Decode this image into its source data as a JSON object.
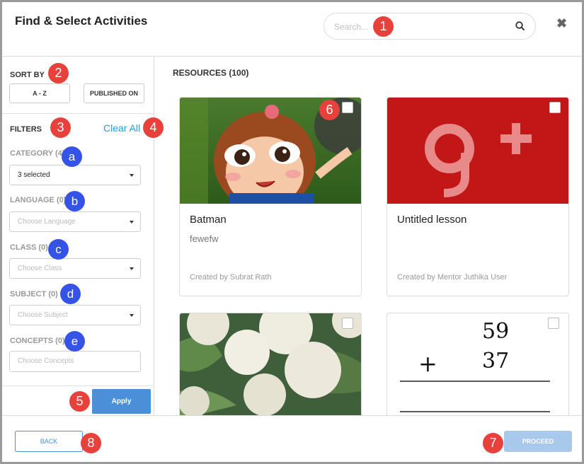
{
  "dialog": {
    "title": "Find & Select Activities",
    "close_glyph": "✖"
  },
  "search": {
    "placeholder": "Search..."
  },
  "sort": {
    "label": "SORT BY",
    "options": [
      "A - Z",
      "PUBLISHED ON"
    ]
  },
  "filters": {
    "label": "FILTERS",
    "clear_label": "Clear All",
    "items": [
      {
        "label": "CATEGORY (4)",
        "value": "3 selected",
        "filled": true
      },
      {
        "label": "LANGUAGE (0)",
        "value": "Choose Language"
      },
      {
        "label": "CLASS (0)",
        "value": "Choose Class"
      },
      {
        "label": "SUBJECT (0)",
        "value": "Choose Subject"
      },
      {
        "label": "CONCEPTS (0)",
        "value": "Choose Concepts"
      }
    ],
    "apply_label": "Apply"
  },
  "resources": {
    "heading": "RESOURCES (100)",
    "cards": [
      {
        "name": "Batman",
        "desc": "fewefw",
        "by": "Created by Subrat Rath",
        "image": "cartoon-girl"
      },
      {
        "name": "Untitled lesson",
        "desc": "",
        "by": "Created by Mentor Juthika User",
        "image": "google-plus-logo"
      },
      {
        "image": "cauliflower"
      },
      {
        "image": "math-addition",
        "math": {
          "top": "59",
          "op": "+",
          "bottom": "37"
        }
      }
    ]
  },
  "footer": {
    "back_label": "BACK",
    "proceed_label": "PROCEED"
  },
  "markers": {
    "red": [
      "1",
      "2",
      "3",
      "4",
      "5",
      "6",
      "7",
      "8"
    ],
    "blue": [
      "a",
      "b",
      "c",
      "d",
      "e"
    ]
  },
  "colors": {
    "accent": "#4a90d9",
    "link": "#1e9fdc",
    "marker_red": "#e8413c",
    "marker_blue": "#3553e6"
  }
}
